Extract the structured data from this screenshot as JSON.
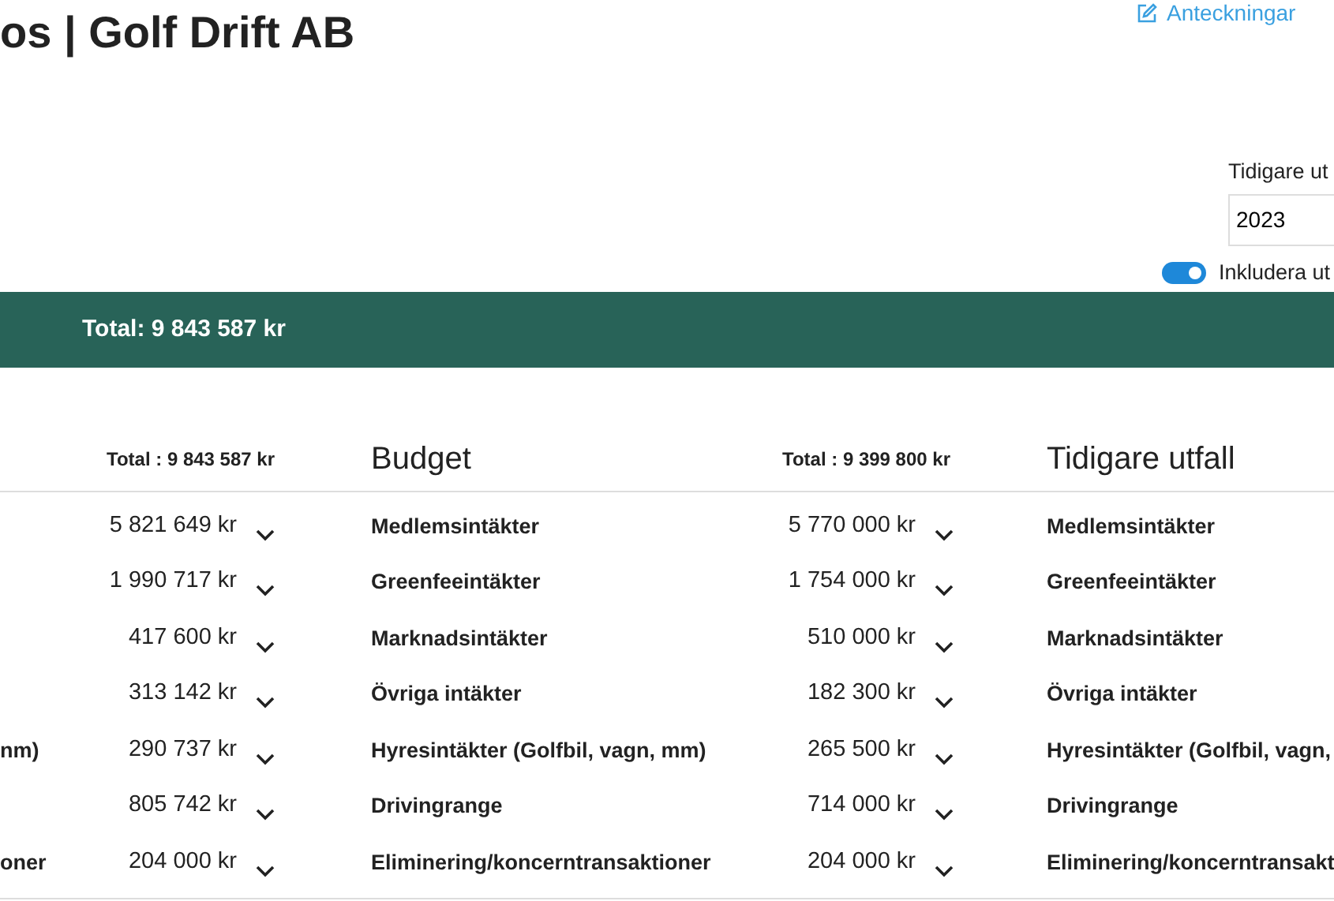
{
  "header": {
    "title": "os | Golf Drift AB",
    "notes_link": "Anteckningar"
  },
  "comparison_filter": {
    "label": "Tidigare ut",
    "value": "2023"
  },
  "include_toggle": {
    "label": "Inkludera ut",
    "on": true
  },
  "total_bar": "Total: 9 843 587 kr",
  "table": {
    "headings": [
      {
        "total": "Total : 9 843 587 kr",
        "title": "Budget"
      },
      {
        "total": "Total : 9 399 800 kr",
        "title": "Tidigare utfall"
      }
    ],
    "rows": [
      {
        "amount_1": "5 821 649 kr",
        "label_2": "Medlemsintäkter",
        "amount_2": "5 770 000 kr",
        "label_3": "Medlemsintäkter"
      },
      {
        "amount_1": "1 990 717 kr",
        "label_2": "Greenfeeintäkter",
        "amount_2": "1 754 000 kr",
        "label_3": "Greenfeeintäkter"
      },
      {
        "amount_1": "417 600 kr",
        "label_2": "Marknadsintäkter",
        "amount_2": "510 000 kr",
        "label_3": "Marknadsintäkter"
      },
      {
        "amount_1": "313 142 kr",
        "label_2": "Övriga intäkter",
        "amount_2": "182 300 kr",
        "label_3": "Övriga intäkter"
      },
      {
        "label_1": "nm)",
        "amount_1": "290 737 kr",
        "label_2": "Hyresintäkter (Golfbil, vagn, mm)",
        "amount_2": "265 500 kr",
        "label_3": "Hyresintäkter (Golfbil, vagn,"
      },
      {
        "amount_1": "805 742 kr",
        "label_2": "Drivingrange",
        "amount_2": "714 000 kr",
        "label_3": "Drivingrange"
      },
      {
        "label_1": "oner",
        "amount_1": "204 000 kr",
        "label_2": "Eliminering/koncerntransaktioner",
        "amount_2": "204 000 kr",
        "label_3": "Eliminering/koncerntransakt"
      }
    ]
  }
}
